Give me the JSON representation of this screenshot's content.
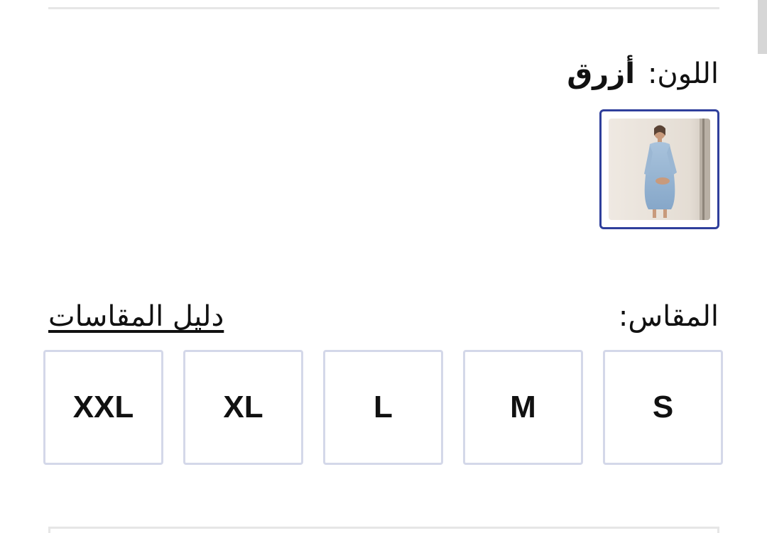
{
  "color": {
    "label": "اللون:",
    "value": "أزرق",
    "swatch_icon": "dress-product-thumbnail",
    "selected_border_color": "#2f3f9c"
  },
  "size": {
    "label": "المقاس:",
    "guide_link": "دليل المقاسات",
    "options": [
      "S",
      "M",
      "L",
      "XL",
      "XXL"
    ],
    "option_border_color": "#d4d8e9"
  }
}
